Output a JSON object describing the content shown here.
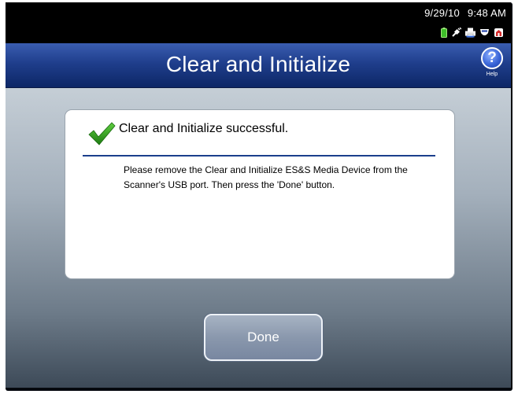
{
  "status_bar": {
    "date": "9/29/10",
    "time": "9:48 AM",
    "icons": [
      "battery-icon",
      "plug-icon",
      "printer-icon",
      "shield-icon",
      "alert-icon"
    ]
  },
  "header": {
    "title": "Clear and Initialize",
    "help_label": "Help",
    "help_glyph": "?"
  },
  "panel": {
    "heading": "Clear and Initialize successful.",
    "message": "Please remove the Clear and Initialize ES&S Media Device from the Scanner's USB port.  Then press the 'Done' button.",
    "icon": "checkmark-icon"
  },
  "actions": {
    "done_label": "Done"
  },
  "colors": {
    "title_bar": "#1f3e8c",
    "check_green": "#2e9b1e",
    "rule_blue": "#1b3f8c"
  }
}
